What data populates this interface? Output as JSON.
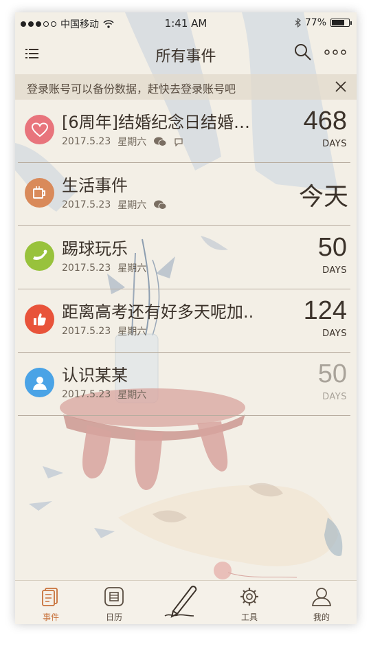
{
  "status_bar": {
    "carrier": "中国移动",
    "time": "1:41 AM",
    "battery": "77%",
    "battery_level": 0.77
  },
  "navbar": {
    "title": "所有事件",
    "menu_icon": "hamburger-menu-icon",
    "search_icon": "search-icon",
    "more_icon": "more-dots-icon"
  },
  "login_banner": {
    "text": "登录账号可以备份数据，赶快去登录账号吧",
    "close_icon": "close-icon"
  },
  "events": [
    {
      "title": "[6周年]结婚纪念日结婚…",
      "date": "2017.5.23",
      "weekday": "星期六",
      "count": "468",
      "unit": "DAYS",
      "icon": "heart-icon",
      "color": "#e8747c"
    },
    {
      "title": "生活事件",
      "date": "2017.5.23",
      "weekday": "星期六",
      "today": "今天",
      "icon": "cup-icon",
      "color": "#d98a5a"
    },
    {
      "title": "踢球玩乐",
      "date": "2017.5.23",
      "weekday": "星期六",
      "count": "50",
      "unit": "DAYS",
      "icon": "play-icon",
      "color": "#98c23c"
    },
    {
      "title": "距离高考还有好多天呢加..",
      "date": "2017.5.23",
      "weekday": "星期六",
      "count": "124",
      "unit": "DAYS",
      "icon": "thumbs-up-icon",
      "color": "#e8533a"
    },
    {
      "title": "认识某某",
      "date": "2017.5.23",
      "weekday": "星期六",
      "count": "50",
      "unit": "DAYS",
      "icon": "person-icon",
      "color": "#4aa3e6"
    }
  ],
  "tabs": [
    {
      "label": "事件",
      "icon": "events-icon",
      "active": true
    },
    {
      "label": "日历",
      "icon": "calendar-icon",
      "active": false
    },
    {
      "label": "",
      "icon": "pencil-icon",
      "active": false
    },
    {
      "label": "工具",
      "icon": "gear-icon",
      "active": false
    },
    {
      "label": "我的",
      "icon": "profile-icon",
      "active": false
    }
  ]
}
